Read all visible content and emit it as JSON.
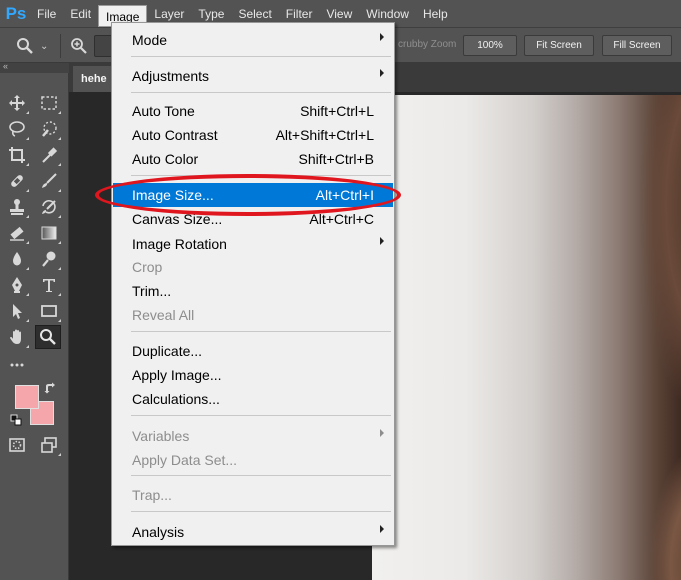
{
  "app": {
    "logo": "Ps"
  },
  "menubar": {
    "items": [
      "File",
      "Edit",
      "Image",
      "Layer",
      "Type",
      "Select",
      "Filter",
      "View",
      "Window",
      "Help"
    ],
    "open_index": 2
  },
  "options_bar": {
    "scrubby_zoom_label": "crubby Zoom",
    "btn_100": "100%",
    "btn_fit": "Fit Screen",
    "btn_fill": "Fill Screen"
  },
  "document": {
    "tab_title": "hehe"
  },
  "colors": {
    "foreground": "#f4a6aa",
    "background": "#f4a6aa",
    "highlight": "#0078d7",
    "annotation": "#e0161e"
  },
  "image_menu": {
    "items": [
      {
        "label": "Mode",
        "shortcut": "",
        "submenu": true,
        "disabled": false
      },
      {
        "label": "Adjustments",
        "shortcut": "",
        "submenu": true,
        "disabled": false
      },
      {
        "label": "Auto Tone",
        "shortcut": "Shift+Ctrl+L",
        "submenu": false,
        "disabled": false
      },
      {
        "label": "Auto Contrast",
        "shortcut": "Alt+Shift+Ctrl+L",
        "submenu": false,
        "disabled": false
      },
      {
        "label": "Auto Color",
        "shortcut": "Shift+Ctrl+B",
        "submenu": false,
        "disabled": false
      },
      {
        "label": "Image Size...",
        "shortcut": "Alt+Ctrl+I",
        "submenu": false,
        "disabled": false,
        "highlighted": true
      },
      {
        "label": "Canvas Size...",
        "shortcut": "Alt+Ctrl+C",
        "submenu": false,
        "disabled": false
      },
      {
        "label": "Image Rotation",
        "shortcut": "",
        "submenu": true,
        "disabled": false
      },
      {
        "label": "Crop",
        "shortcut": "",
        "submenu": false,
        "disabled": true
      },
      {
        "label": "Trim...",
        "shortcut": "",
        "submenu": false,
        "disabled": false
      },
      {
        "label": "Reveal All",
        "shortcut": "",
        "submenu": false,
        "disabled": true
      },
      {
        "label": "Duplicate...",
        "shortcut": "",
        "submenu": false,
        "disabled": false
      },
      {
        "label": "Apply Image...",
        "shortcut": "",
        "submenu": false,
        "disabled": false
      },
      {
        "label": "Calculations...",
        "shortcut": "",
        "submenu": false,
        "disabled": false
      },
      {
        "label": "Variables",
        "shortcut": "",
        "submenu": true,
        "disabled": true
      },
      {
        "label": "Apply Data Set...",
        "shortcut": "",
        "submenu": false,
        "disabled": true
      },
      {
        "label": "Trap...",
        "shortcut": "",
        "submenu": false,
        "disabled": true
      },
      {
        "label": "Analysis",
        "shortcut": "",
        "submenu": true,
        "disabled": false
      }
    ]
  },
  "tools": [
    "move-tool-icon",
    "marquee-tool-icon",
    "lasso-tool-icon",
    "quick-select-tool-icon",
    "crop-tool-icon",
    "eyedropper-tool-icon",
    "healing-brush-icon",
    "brush-tool-icon",
    "clone-stamp-icon",
    "history-brush-icon",
    "eraser-tool-icon",
    "gradient-tool-icon",
    "blur-tool-icon",
    "dodge-tool-icon",
    "pen-tool-icon",
    "type-tool-icon",
    "path-select-icon",
    "rectangle-tool-icon",
    "hand-tool-icon",
    "zoom-tool-icon"
  ]
}
